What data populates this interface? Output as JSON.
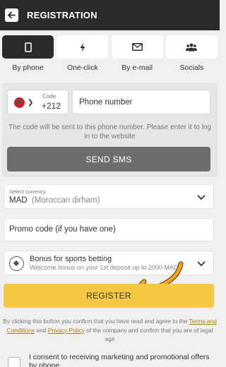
{
  "header": {
    "title": "REGISTRATION"
  },
  "tabs": [
    {
      "label": "By phone",
      "icon": "phone-icon",
      "active": true
    },
    {
      "label": "One-click",
      "icon": "lightning-icon",
      "active": false
    },
    {
      "label": "By e-mail",
      "icon": "envelope-icon",
      "active": false
    },
    {
      "label": "Socials",
      "icon": "people-icon",
      "active": false
    }
  ],
  "phone_panel": {
    "code_label": "Code",
    "code_value": "+212",
    "phone_placeholder": "Phone number",
    "hint": "The code will be sent to this phone number. Please enter it to log in to the website",
    "sms_button": "SEND SMS"
  },
  "currency": {
    "label": "Select currency",
    "code": "MAD",
    "name": "(Moroccan dirham)"
  },
  "promo": {
    "placeholder": "Promo code (if you have one)"
  },
  "bonus": {
    "title": "Bonus for sports betting",
    "subtitle": "Welcome bonus on your 1st deposit up to 2000 MAD"
  },
  "register_button": "REGISTER",
  "terms": {
    "p1": "By clicking this button you confirm that you have read and agree to the ",
    "link1": "Terms and Conditions",
    "p2": " and ",
    "link2": "Privacy Policy",
    "p3": " of the company and confirm that you are of legal age"
  },
  "consent": {
    "label": "I consent to receiving marketing and promotional offers by phone"
  },
  "colors": {
    "header_bg": "#2a2a2a",
    "accent_yellow": "#f7c843",
    "arrow_orange": "#f5a623",
    "link": "#b07c10",
    "sms_button_bg": "#6d6d6d"
  }
}
